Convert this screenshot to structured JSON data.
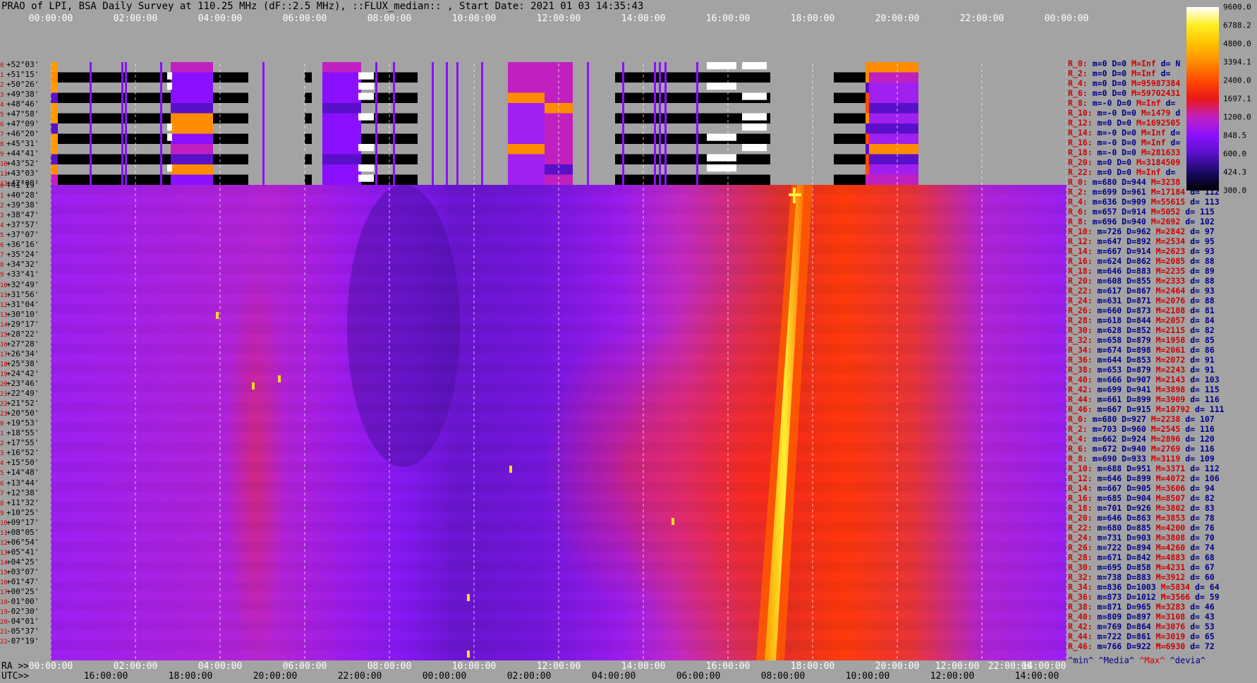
{
  "title": "PRAO of LPI, BSA Daily Survey at 110.25 MHz (dF::2.5 MHz), ::FLUX_median:: , Start Date: 2021 01 03 14:35:43",
  "top_ticks": [
    "00:00:00",
    "02:00:00",
    "04:00:00",
    "06:00:00",
    "08:00:00",
    "10:00:00",
    "12:00:00",
    "14:00:00",
    "16:00:00",
    "18:00:00",
    "20:00:00",
    "22:00:00",
    "00:00:00"
  ],
  "ra_label": "RA >>",
  "ra_ticks": [
    "00:00:00",
    "02:00:00",
    "04:00:00",
    "06:00:00",
    "08:00:00",
    "10:00:00",
    "12:00:00",
    "14:00:00",
    "16:00:00",
    "18:00:00",
    "20:00:00",
    "12:00:00",
    "22:00:00",
    "14:00:00"
  ],
  "utc_label": "UTC>>",
  "utc_ticks": [
    "16:00:00",
    "18:00:00",
    "20:00:00",
    "22:00:00",
    "00:00:00",
    "02:00:00",
    "04:00:00",
    "06:00:00",
    "08:00:00",
    "10:00:00",
    "12:00:00",
    "14:00:00"
  ],
  "dec_labels": [
    {
      "n": "0",
      "v": "+52°03'"
    },
    {
      "n": "1",
      "v": "+51°15'"
    },
    {
      "n": "2",
      "v": "+50°26'"
    },
    {
      "n": "3",
      "v": "+49°38'"
    },
    {
      "n": "4",
      "v": "+48°46'"
    },
    {
      "n": "5",
      "v": "+47°58'"
    },
    {
      "n": "6",
      "v": "+47°09'"
    },
    {
      "n": "7",
      "v": "+46°20'"
    },
    {
      "n": "8",
      "v": "+45°31'"
    },
    {
      "n": "9",
      "v": "+44°41'"
    },
    {
      "n": "10",
      "v": "+43°52'"
    },
    {
      "n": "11",
      "v": "+43°03'"
    },
    {
      "n": "12",
      "v": "+42°08'"
    },
    {
      "n": "0",
      "v": "+41°19'"
    },
    {
      "n": "1",
      "v": "+40°28'"
    },
    {
      "n": "2",
      "v": "+39°38'"
    },
    {
      "n": "3",
      "v": "+38°47'"
    },
    {
      "n": "4",
      "v": "+37°57'"
    },
    {
      "n": "5",
      "v": "+37°07'"
    },
    {
      "n": "6",
      "v": "+36°16'"
    },
    {
      "n": "7",
      "v": "+35°24'"
    },
    {
      "n": "8",
      "v": "+34°32'"
    },
    {
      "n": "9",
      "v": "+33°41'"
    },
    {
      "n": "10",
      "v": "+32°49'"
    },
    {
      "n": "11",
      "v": "+31°56'"
    },
    {
      "n": "12",
      "v": "+31°04'"
    },
    {
      "n": "13",
      "v": "+30°10'"
    },
    {
      "n": "14",
      "v": "+29°17'"
    },
    {
      "n": "15",
      "v": "+28°22'"
    },
    {
      "n": "16",
      "v": "+27°28'"
    },
    {
      "n": "17",
      "v": "+26°34'"
    },
    {
      "n": "18",
      "v": "+25°38'"
    },
    {
      "n": "19",
      "v": "+24°42'"
    },
    {
      "n": "20",
      "v": "+23°46'"
    },
    {
      "n": "21",
      "v": "+22°49'"
    },
    {
      "n": "22",
      "v": "+21°52'"
    },
    {
      "n": "23",
      "v": "+20°50'"
    },
    {
      "n": "0",
      "v": "+19°53'"
    },
    {
      "n": "1",
      "v": "+18°55'"
    },
    {
      "n": "2",
      "v": "+17°55'"
    },
    {
      "n": "3",
      "v": "+16°52'"
    },
    {
      "n": "4",
      "v": "+15°50'"
    },
    {
      "n": "5",
      "v": "+14°48'"
    },
    {
      "n": "6",
      "v": "+13°44'"
    },
    {
      "n": "7",
      "v": "+12°38'"
    },
    {
      "n": "8",
      "v": "+11°32'"
    },
    {
      "n": "9",
      "v": "+10°25'"
    },
    {
      "n": "10",
      "v": "+09°17'"
    },
    {
      "n": "11",
      "v": "+08°05'"
    },
    {
      "n": "12",
      "v": "+06°54'"
    },
    {
      "n": "13",
      "v": "+05°41'"
    },
    {
      "n": "14",
      "v": "+04°25'"
    },
    {
      "n": "15",
      "v": "+03°07'"
    },
    {
      "n": "16",
      "v": "+01°47'"
    },
    {
      "n": "17",
      "v": "+00°25'"
    },
    {
      "n": "18",
      "v": "-01°00'"
    },
    {
      "n": "19",
      "v": "-02°30'"
    },
    {
      "n": "20",
      "v": "-04°01'"
    },
    {
      "n": "21",
      "v": "-05°37'"
    },
    {
      "n": "22",
      "v": "-07°19'"
    }
  ],
  "stats": [
    {
      "r": "R_0:",
      "m": "m=0",
      "d": "D=0",
      "h": "M=Inf",
      "dv": "d= N"
    },
    {
      "r": "R_2:",
      "m": "m=0",
      "d": "D=0",
      "h": "M=Inf",
      "dv": "d="
    },
    {
      "r": "R_4:",
      "m": "m=0",
      "d": "D=0",
      "h": "M=95987384",
      "dv": ""
    },
    {
      "r": "R_6:",
      "m": "m=0",
      "d": "D=0",
      "h": "M=59702431",
      "dv": ""
    },
    {
      "r": "R_8:",
      "m": "m=-0",
      "d": "D=0",
      "h": "M=Inf",
      "dv": "d="
    },
    {
      "r": "R_10:",
      "m": "m=-0",
      "d": "D=0",
      "h": "M=1479",
      "dv": "d"
    },
    {
      "r": "R_12:",
      "m": "m=0",
      "d": "D=0",
      "h": "M=1692505",
      "dv": ""
    },
    {
      "r": "R_14:",
      "m": "m=-0",
      "d": "D=0",
      "h": "M=Inf",
      "dv": "d="
    },
    {
      "r": "R_16:",
      "m": "m=-0",
      "d": "D=0",
      "h": "M=Inf",
      "dv": "d="
    },
    {
      "r": "R_18:",
      "m": "m=-0",
      "d": "D=0",
      "h": "M=281633",
      "dv": ""
    },
    {
      "r": "R_20:",
      "m": "m=0",
      "d": "D=0",
      "h": "M=3184509",
      "dv": ""
    },
    {
      "r": "R_22:",
      "m": "m=0",
      "d": "D=0",
      "h": "M=Inf",
      "dv": "d="
    },
    {
      "r": "R_0:",
      "m": "m=680",
      "d": "D=944",
      "h": "M=3238",
      "dv": ""
    },
    {
      "r": "R_2:",
      "m": "m=699",
      "d": "D=961",
      "h": "M=17184",
      "dv": "d= 112"
    },
    {
      "r": "R_4:",
      "m": "m=636",
      "d": "D=909",
      "h": "M=55615",
      "dv": "d= 113"
    },
    {
      "r": "R_6:",
      "m": "m=657",
      "d": "D=914",
      "h": "M=5052",
      "dv": "d= 115"
    },
    {
      "r": "R_8:",
      "m": "m=696",
      "d": "D=940",
      "h": "M=2692",
      "dv": "d= 102"
    },
    {
      "r": "R_10:",
      "m": "m=726",
      "d": "D=962",
      "h": "M=2842",
      "dv": "d= 97"
    },
    {
      "r": "R_12:",
      "m": "m=647",
      "d": "D=892",
      "h": "M=2534",
      "dv": "d= 95"
    },
    {
      "r": "R_14:",
      "m": "m=667",
      "d": "D=914",
      "h": "M=2623",
      "dv": "d= 93"
    },
    {
      "r": "R_16:",
      "m": "m=624",
      "d": "D=862",
      "h": "M=2085",
      "dv": "d= 88"
    },
    {
      "r": "R_18:",
      "m": "m=646",
      "d": "D=883",
      "h": "M=2235",
      "dv": "d= 89"
    },
    {
      "r": "R_20:",
      "m": "m=608",
      "d": "D=855",
      "h": "M=2333",
      "dv": "d= 88"
    },
    {
      "r": "R_22:",
      "m": "m=617",
      "d": "D=867",
      "h": "M=2464",
      "dv": "d= 93"
    },
    {
      "r": "R_24:",
      "m": "m=631",
      "d": "D=871",
      "h": "M=2076",
      "dv": "d= 88"
    },
    {
      "r": "R_26:",
      "m": "m=660",
      "d": "D=873",
      "h": "M=2188",
      "dv": "d= 81"
    },
    {
      "r": "R_28:",
      "m": "m=618",
      "d": "D=844",
      "h": "M=2057",
      "dv": "d= 84"
    },
    {
      "r": "R_30:",
      "m": "m=628",
      "d": "D=852",
      "h": "M=2115",
      "dv": "d= 82"
    },
    {
      "r": "R_32:",
      "m": "m=658",
      "d": "D=879",
      "h": "M=1958",
      "dv": "d= 85"
    },
    {
      "r": "R_34:",
      "m": "m=674",
      "d": "D=898",
      "h": "M=2061",
      "dv": "d= 86"
    },
    {
      "r": "R_36:",
      "m": "m=644",
      "d": "D=853",
      "h": "M=2072",
      "dv": "d= 91"
    },
    {
      "r": "R_38:",
      "m": "m=653",
      "d": "D=879",
      "h": "M=2243",
      "dv": "d= 91"
    },
    {
      "r": "R_40:",
      "m": "m=666",
      "d": "D=907",
      "h": "M=2143",
      "dv": "d= 103"
    },
    {
      "r": "R_42:",
      "m": "m=699",
      "d": "D=941",
      "h": "M=3898",
      "dv": "d= 115"
    },
    {
      "r": "R_44:",
      "m": "m=661",
      "d": "D=899",
      "h": "M=3909",
      "dv": "d= 116"
    },
    {
      "r": "R_46:",
      "m": "m=667",
      "d": "D=915",
      "h": "M=10792",
      "dv": "d= 111"
    },
    {
      "r": "R_0:",
      "m": "m=680",
      "d": "D=927",
      "h": "M=2238",
      "dv": "d= 107"
    },
    {
      "r": "R_2:",
      "m": "m=703",
      "d": "D=960",
      "h": "M=2545",
      "dv": "d= 116"
    },
    {
      "r": "R_4:",
      "m": "m=662",
      "d": "D=924",
      "h": "M=2896",
      "dv": "d= 120"
    },
    {
      "r": "R_6:",
      "m": "m=672",
      "d": "D=940",
      "h": "M=2769",
      "dv": "d= 116"
    },
    {
      "r": "R_8:",
      "m": "m=690",
      "d": "D=933",
      "h": "M=3119",
      "dv": "d= 109"
    },
    {
      "r": "R_10:",
      "m": "m=688",
      "d": "D=951",
      "h": "M=3371",
      "dv": "d= 112"
    },
    {
      "r": "R_12:",
      "m": "m=646",
      "d": "D=899",
      "h": "M=4072",
      "dv": "d= 106"
    },
    {
      "r": "R_14:",
      "m": "m=667",
      "d": "D=905",
      "h": "M=3606",
      "dv": "d= 94"
    },
    {
      "r": "R_16:",
      "m": "m=685",
      "d": "D=904",
      "h": "M=8507",
      "dv": "d= 82"
    },
    {
      "r": "R_18:",
      "m": "m=701",
      "d": "D=926",
      "h": "M=3802",
      "dv": "d= 83"
    },
    {
      "r": "R_20:",
      "m": "m=646",
      "d": "D=863",
      "h": "M=3853",
      "dv": "d= 78"
    },
    {
      "r": "R_22:",
      "m": "m=680",
      "d": "D=885",
      "h": "M=4200",
      "dv": "d= 76"
    },
    {
      "r": "R_24:",
      "m": "m=731",
      "d": "D=903",
      "h": "M=3808",
      "dv": "d= 70"
    },
    {
      "r": "R_26:",
      "m": "m=722",
      "d": "D=894",
      "h": "M=4260",
      "dv": "d= 74"
    },
    {
      "r": "R_28:",
      "m": "m=671",
      "d": "D=842",
      "h": "M=4883",
      "dv": "d= 68"
    },
    {
      "r": "R_30:",
      "m": "m=695",
      "d": "D=858",
      "h": "M=4231",
      "dv": "d= 67"
    },
    {
      "r": "R_32:",
      "m": "m=738",
      "d": "D=883",
      "h": "M=3912",
      "dv": "d= 60"
    },
    {
      "r": "R_34:",
      "m": "m=836",
      "d": "D=1003",
      "h": "M=5834",
      "dv": "d= 64"
    },
    {
      "r": "R_36:",
      "m": "m=873",
      "d": "D=1012",
      "h": "M=3566",
      "dv": "d= 59"
    },
    {
      "r": "R_38:",
      "m": "m=871",
      "d": "D=965",
      "h": "M=3283",
      "dv": "d= 46"
    },
    {
      "r": "R_40:",
      "m": "m=809",
      "d": "D=897",
      "h": "M=3108",
      "dv": "d= 43"
    },
    {
      "r": "R_42:",
      "m": "m=769",
      "d": "D=864",
      "h": "M=3076",
      "dv": "d= 53"
    },
    {
      "r": "R_44:",
      "m": "m=722",
      "d": "D=861",
      "h": "M=3019",
      "dv": "d= 65"
    },
    {
      "r": "R_46:",
      "m": "m=766",
      "d": "D=922",
      "h": "M=6930",
      "dv": "d= 72"
    }
  ],
  "legend_foot": {
    "min": "^min^",
    "median": "^Media^",
    "max": "^Max^",
    "dev": "^devia^"
  },
  "colorbar": {
    "labels": [
      "9600.0",
      "6788.2",
      "4800.0",
      "3394.1",
      "2400.0",
      "1697.1",
      "1200.0",
      "848.5",
      "600.0",
      "424.3",
      "300.0"
    ],
    "colors": [
      "#000000",
      "#1a0a66",
      "#5a10c8",
      "#8a10ff",
      "#c020c0",
      "#e81818",
      "#ff4a00",
      "#ff8c00",
      "#ffc000",
      "#ffee20",
      "#ffffff"
    ]
  },
  "chart_data": {
    "type": "heatmap",
    "title": "PRAO of LPI, BSA Daily Survey at 110.25 MHz (dF::2.5 MHz), ::FLUX_median:: , Start Date: 2021 01 03 14:35:43",
    "x_axis_top": "00:00:00 – 00:00:00",
    "x_range_hours": [
      0,
      24
    ],
    "y_range_deg": [
      -7.32,
      52.05
    ],
    "color_scale": "log",
    "color_range": [
      300.0,
      9600.0
    ],
    "gridlines": "dashed vertical every 2h",
    "features": [
      {
        "name": "bright diagonal band (Galactic plane)",
        "start_hour": 18.5,
        "end_hour": 20.6,
        "dec_start": -7.32,
        "dec_end": 42.13
      },
      {
        "name": "source Cas A region",
        "hour": 20.0,
        "dec": 40.5
      },
      {
        "name": "cold region",
        "hour_range": [
          8.5,
          11.5
        ],
        "dec_range": [
          15,
          40
        ]
      }
    ],
    "top_band_rows": 12,
    "bottom_rows": 48
  }
}
